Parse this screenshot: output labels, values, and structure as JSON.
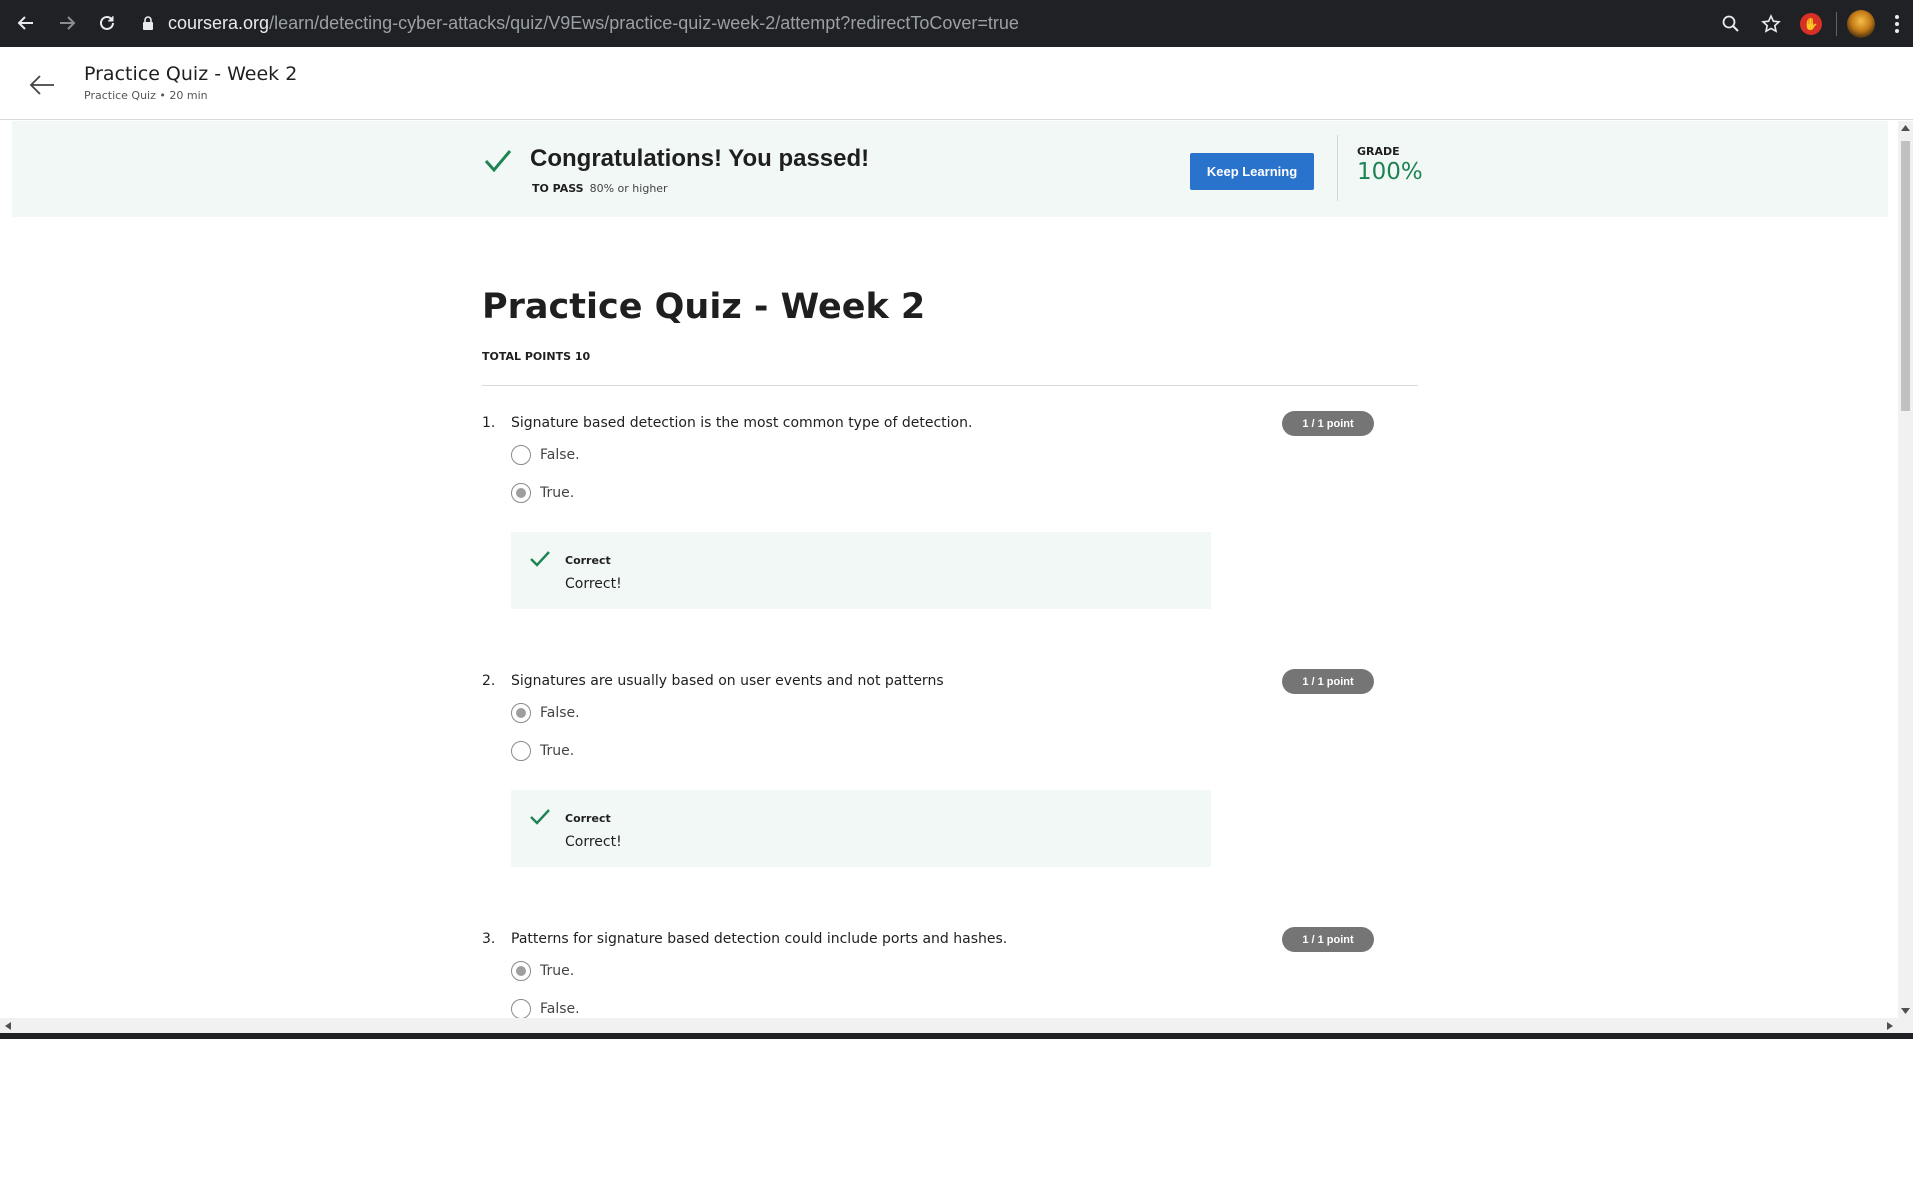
{
  "browser": {
    "url_host": "coursera.org",
    "url_path": "/learn/detecting-cyber-attacks/quiz/V9Ews/practice-quiz-week-2/attempt?redirectToCover=true"
  },
  "header": {
    "title": "Practice Quiz - Week 2",
    "subtitle": "Practice Quiz • 20 min"
  },
  "banner": {
    "message": "Congratulations! You passed!",
    "to_pass_label": "TO PASS",
    "to_pass_value": "80% or higher",
    "button_label": "Keep Learning",
    "grade_label": "GRADE",
    "grade_value": "100%"
  },
  "quiz": {
    "title": "Practice Quiz - Week 2",
    "total_points": "TOTAL POINTS 10",
    "questions": [
      {
        "number": "1.",
        "text": "Signature based detection is the most common type of detection.",
        "points": "1 / 1 point",
        "options": [
          {
            "label": "False.",
            "selected": false
          },
          {
            "label": "True.",
            "selected": true
          }
        ],
        "feedback_title": "Correct",
        "feedback_text": "Correct!"
      },
      {
        "number": "2.",
        "text": "Signatures are usually based on user events and not patterns",
        "points": "1 / 1 point",
        "options": [
          {
            "label": "False.",
            "selected": true
          },
          {
            "label": "True.",
            "selected": false
          }
        ],
        "feedback_title": "Correct",
        "feedback_text": "Correct!"
      },
      {
        "number": "3.",
        "text": "Patterns for signature based detection could include ports and hashes.",
        "points": "1 / 1 point",
        "options": [
          {
            "label": "True.",
            "selected": true
          },
          {
            "label": "False.",
            "selected": false
          }
        ]
      }
    ]
  },
  "colors": {
    "success_green": "#1f8354",
    "primary_blue": "#2a73cc",
    "banner_bg": "#f2f8f6",
    "badge_grey": "#757575"
  }
}
